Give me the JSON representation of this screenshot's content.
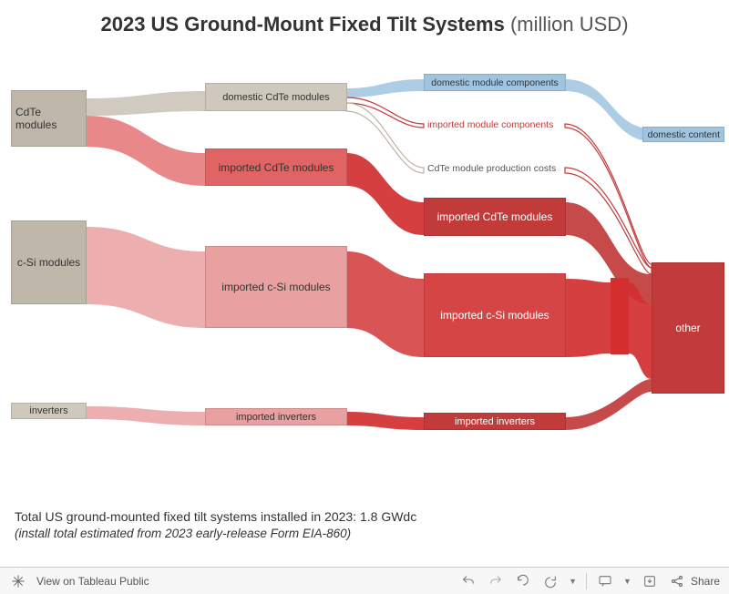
{
  "title_main": "2023 US Ground-Mount Fixed Tilt Systems",
  "title_unit": "(million USD)",
  "caption_line1": "Total US ground-mounted fixed tilt systems installed in 2023: 1.8 GWdc",
  "caption_line2": "(install total estimated from 2023 early-release Form EIA-860)",
  "toolbar": {
    "view_label": "View on Tableau Public",
    "share_label": "Share"
  },
  "nodes": {
    "cdte": "CdTe modules",
    "csi": "c-Si modules",
    "inverters": "inverters",
    "dom_cdte": "domestic CdTe modules",
    "imp_cdte": "imported CdTe modules",
    "imp_csi": "imported c-Si modules",
    "imp_inv": "imported inverters",
    "dom_comp": "domestic module components",
    "imp_comp": "imported module components",
    "cdte_cost": "CdTe module production costs",
    "imp_cdte2": "imported CdTe modules",
    "imp_csi2": "imported c-Si modules",
    "imp_inv2": "imported inverters",
    "dom_content": "domestic content",
    "other": "other"
  },
  "chart_data": {
    "type": "sankey",
    "title": "2023 US Ground-Mount Fixed Tilt Systems (million USD)",
    "unit": "million USD",
    "levels": 5,
    "nodes": [
      {
        "id": "cdte",
        "level": 0,
        "label": "CdTe modules",
        "value": 60
      },
      {
        "id": "csi",
        "level": 0,
        "label": "c-Si modules",
        "value": 95
      },
      {
        "id": "inverters",
        "level": 0,
        "label": "inverters",
        "value": 15
      },
      {
        "id": "dom_cdte",
        "level": 1,
        "label": "domestic CdTe modules",
        "value": 26
      },
      {
        "id": "imp_cdte",
        "level": 1,
        "label": "imported CdTe modules",
        "value": 34
      },
      {
        "id": "imp_csi",
        "level": 1,
        "label": "imported c-Si modules",
        "value": 95
      },
      {
        "id": "imp_inv",
        "level": 1,
        "label": "imported inverters",
        "value": 15
      },
      {
        "id": "dom_comp",
        "level": 2,
        "label": "domestic module components",
        "value": 13
      },
      {
        "id": "imp_comp",
        "level": 2,
        "label": "imported module components",
        "value": 5
      },
      {
        "id": "cdte_cost",
        "level": 2,
        "label": "CdTe module production costs",
        "value": 8
      },
      {
        "id": "imp_cdte2",
        "level": 2,
        "label": "imported CdTe modules",
        "value": 34
      },
      {
        "id": "imp_csi2",
        "level": 2,
        "label": "imported c-Si modules",
        "value": 95
      },
      {
        "id": "imp_inv2",
        "level": 2,
        "label": "imported inverters",
        "value": 15
      },
      {
        "id": "dom_content",
        "level": 4,
        "label": "domestic content",
        "value": 13
      },
      {
        "id": "other",
        "level": 4,
        "label": "other",
        "value": 157
      }
    ],
    "links": [
      {
        "source": "cdte",
        "target": "dom_cdte",
        "value": 26,
        "color": "#bba"
      },
      {
        "source": "cdte",
        "target": "imp_cdte",
        "value": 34,
        "color": "#e57373"
      },
      {
        "source": "csi",
        "target": "imp_csi",
        "value": 95,
        "color": "#e57373"
      },
      {
        "source": "inverters",
        "target": "imp_inv",
        "value": 15,
        "color": "#e57373"
      },
      {
        "source": "dom_cdte",
        "target": "dom_comp",
        "value": 13,
        "color": "#8fb8d8"
      },
      {
        "source": "dom_cdte",
        "target": "imp_comp",
        "value": 5,
        "color": "#d32f2f"
      },
      {
        "source": "dom_cdte",
        "target": "cdte_cost",
        "value": 8,
        "color": "#bba"
      },
      {
        "source": "imp_cdte",
        "target": "imp_cdte2",
        "value": 34,
        "color": "#d32f2f"
      },
      {
        "source": "imp_csi",
        "target": "imp_csi2",
        "value": 95,
        "color": "#d32f2f"
      },
      {
        "source": "imp_inv",
        "target": "imp_inv2",
        "value": 15,
        "color": "#d32f2f"
      },
      {
        "source": "dom_comp",
        "target": "dom_content",
        "value": 13,
        "color": "#8fb8d8"
      },
      {
        "source": "imp_comp",
        "target": "other",
        "value": 5,
        "color": "#d32f2f"
      },
      {
        "source": "cdte_cost",
        "target": "other",
        "value": 8,
        "color": "#d32f2f"
      },
      {
        "source": "imp_cdte2",
        "target": "other",
        "value": 34,
        "color": "#d32f2f"
      },
      {
        "source": "imp_csi2",
        "target": "other",
        "value": 95,
        "color": "#d32f2f"
      },
      {
        "source": "imp_inv2",
        "target": "other",
        "value": 15,
        "color": "#d32f2f"
      }
    ]
  }
}
